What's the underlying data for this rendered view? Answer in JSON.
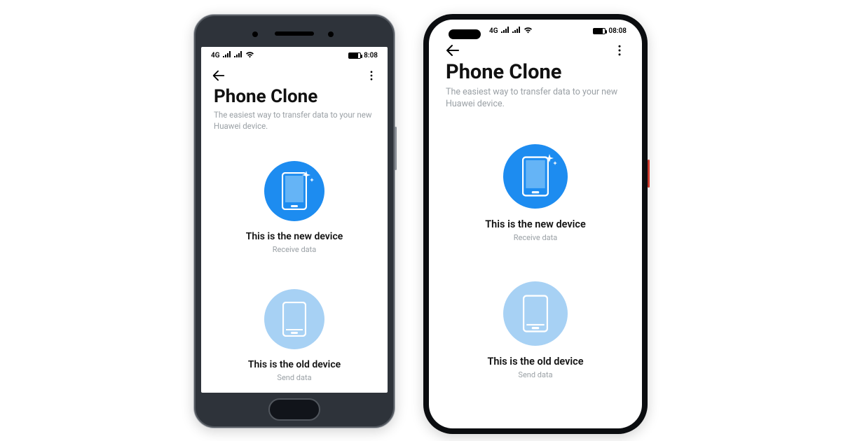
{
  "shared": {
    "status_time": "8:08",
    "status_time_b": "08:08",
    "app_title": "Phone Clone",
    "app_subtitle": "The easiest way to transfer data to your new Huawei device.",
    "option_new_title": "This is the new device",
    "option_new_sub": "Receive data",
    "option_old_title": "This is the old device",
    "option_old_sub": "Send data",
    "network_label": "4G"
  },
  "colors": {
    "accent_new": "#1d8cf0",
    "accent_old": "#a7d1f4"
  }
}
